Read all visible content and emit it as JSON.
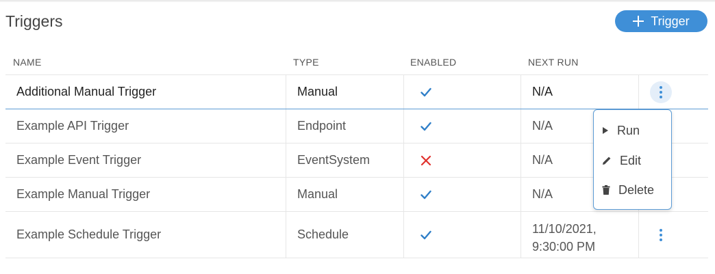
{
  "page": {
    "title": "Triggers"
  },
  "toolbar": {
    "add_label": "Trigger"
  },
  "table": {
    "headers": {
      "name": "NAME",
      "type": "TYPE",
      "enabled": "ENABLED",
      "next_run": "NEXT RUN"
    },
    "rows": [
      {
        "name": "Additional Manual Trigger",
        "type": "Manual",
        "enabled": true,
        "next_run": "N/A"
      },
      {
        "name": "Example API Trigger",
        "type": "Endpoint",
        "enabled": true,
        "next_run": "N/A"
      },
      {
        "name": "Example Event Trigger",
        "type": "EventSystem",
        "enabled": false,
        "next_run": "N/A"
      },
      {
        "name": "Example Manual Trigger",
        "type": "Manual",
        "enabled": true,
        "next_run": "N/A"
      },
      {
        "name": "Example Schedule Trigger",
        "type": "Schedule",
        "enabled": true,
        "next_run_date": "11/10/2021,",
        "next_run_time": "9:30:00 PM"
      }
    ]
  },
  "context_menu": {
    "run_label": "Run",
    "edit_label": "Edit",
    "delete_label": "Delete"
  },
  "icons": {
    "enabled": "check-icon",
    "disabled": "cross-icon",
    "actions": "kebab-icon",
    "run": "play-icon",
    "edit": "pencil-icon",
    "delete": "trash-icon"
  },
  "colors": {
    "accent": "#3f8fd7",
    "check": "#2f7fc8",
    "cross": "#e0302c"
  }
}
